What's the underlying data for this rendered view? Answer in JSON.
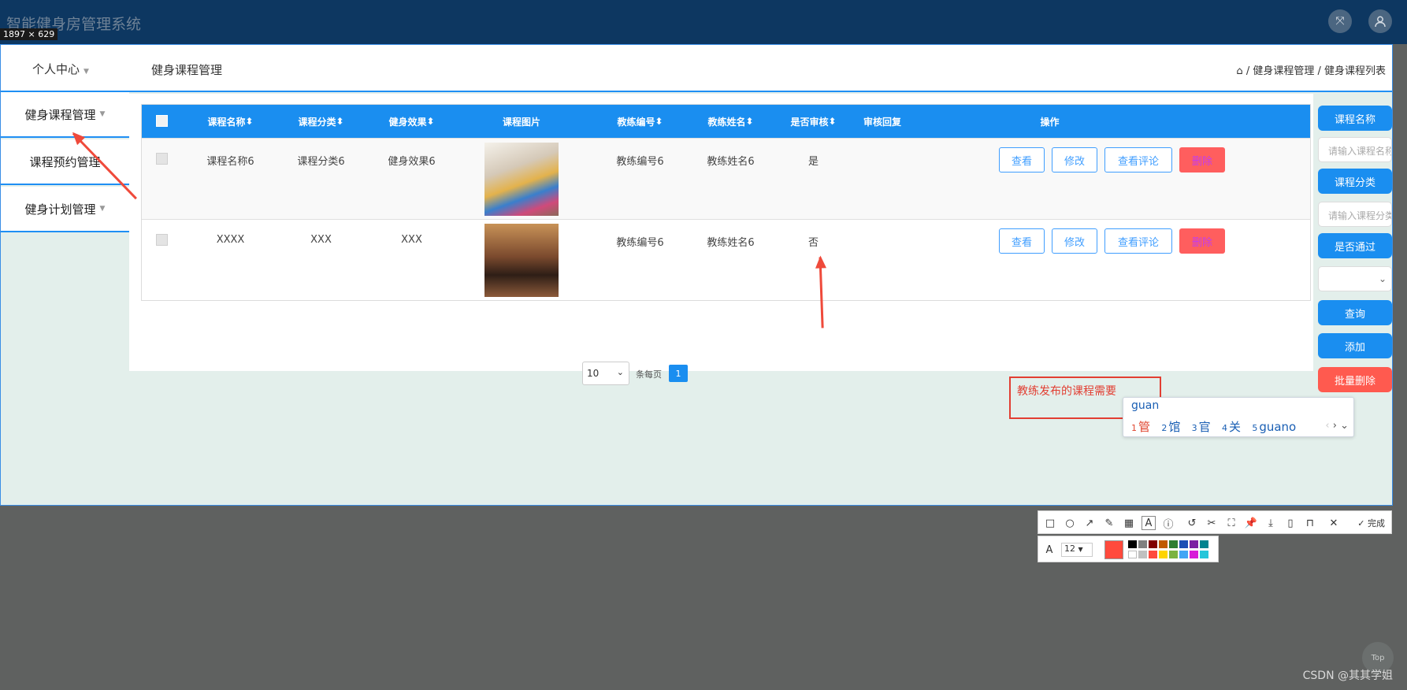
{
  "app": {
    "title": "智能健身房管理系统",
    "dimensions_badge": "1897 × 629"
  },
  "header": {
    "user_menu": "个人中心",
    "page_title": "健身课程管理",
    "breadcrumb": "/ 健身课程管理 / 健身课程列表"
  },
  "sidebar": {
    "items": [
      {
        "label": "健身课程管理"
      },
      {
        "label": "课程预约管理"
      },
      {
        "label": "健身计划管理"
      }
    ]
  },
  "table": {
    "columns": [
      "课程名称",
      "课程分类",
      "健身效果",
      "课程图片",
      "教练编号",
      "教练姓名",
      "是否审核",
      "审核回复",
      "操作"
    ],
    "rows": [
      {
        "name": "课程名称6",
        "category": "课程分类6",
        "effect": "健身效果6",
        "coach_no": "教练编号6",
        "coach_name": "教练姓名6",
        "approved": "是",
        "reply": ""
      },
      {
        "name": "XXXX",
        "category": "XXX",
        "effect": "XXX",
        "coach_no": "教练编号6",
        "coach_name": "教练姓名6",
        "approved": "否",
        "reply": ""
      }
    ],
    "actions": {
      "view": "查看",
      "edit": "修改",
      "comments": "查看评论",
      "delete": "删除"
    }
  },
  "pagination": {
    "page_size": "10",
    "per_page_label": "条每页",
    "current_page": "1"
  },
  "filters": {
    "name_button": "课程名称",
    "name_placeholder": "请输入课程名称",
    "category_button": "课程分类",
    "category_placeholder": "请输入课程分类",
    "pass_button": "是否通过",
    "query": "查询",
    "add": "添加",
    "batch_delete": "批量删除"
  },
  "annotation": {
    "text": "教练发布的课程需要",
    "ime_input": "guan",
    "candidates": [
      "管",
      "馆",
      "官",
      "关",
      "guano"
    ]
  },
  "screenshot_toolbar": {
    "done_label": "完成",
    "font_size": "12",
    "current_color": "#ff4a3d",
    "palette": [
      "#000000",
      "#808080",
      "#800000",
      "#c05a00",
      "#2e7d32",
      "#1e4fb4",
      "#7b1fa2",
      "#00838f",
      "#ffffff",
      "#c0c0c0",
      "#ff4a3d",
      "#ffd400",
      "#7cb342",
      "#42a5f5",
      "#d81bd8",
      "#26c6da"
    ],
    "tools": [
      "rect-icon",
      "ellipse-icon",
      "arrow-icon",
      "pen-icon",
      "mosaic-icon",
      "text-icon",
      "number-icon",
      "undo-icon",
      "scissors-icon",
      "scan-icon",
      "pin-icon",
      "download-icon",
      "phone-icon",
      "bookmark-icon",
      "close-icon"
    ]
  },
  "watermark": "CSDN @其其学姐",
  "back_to_top": "Top",
  "colors": {
    "primary": "#1a8ef0",
    "danger": "#ff5a4f",
    "annotation": "#e23e32",
    "topbar": "#0d3761"
  }
}
